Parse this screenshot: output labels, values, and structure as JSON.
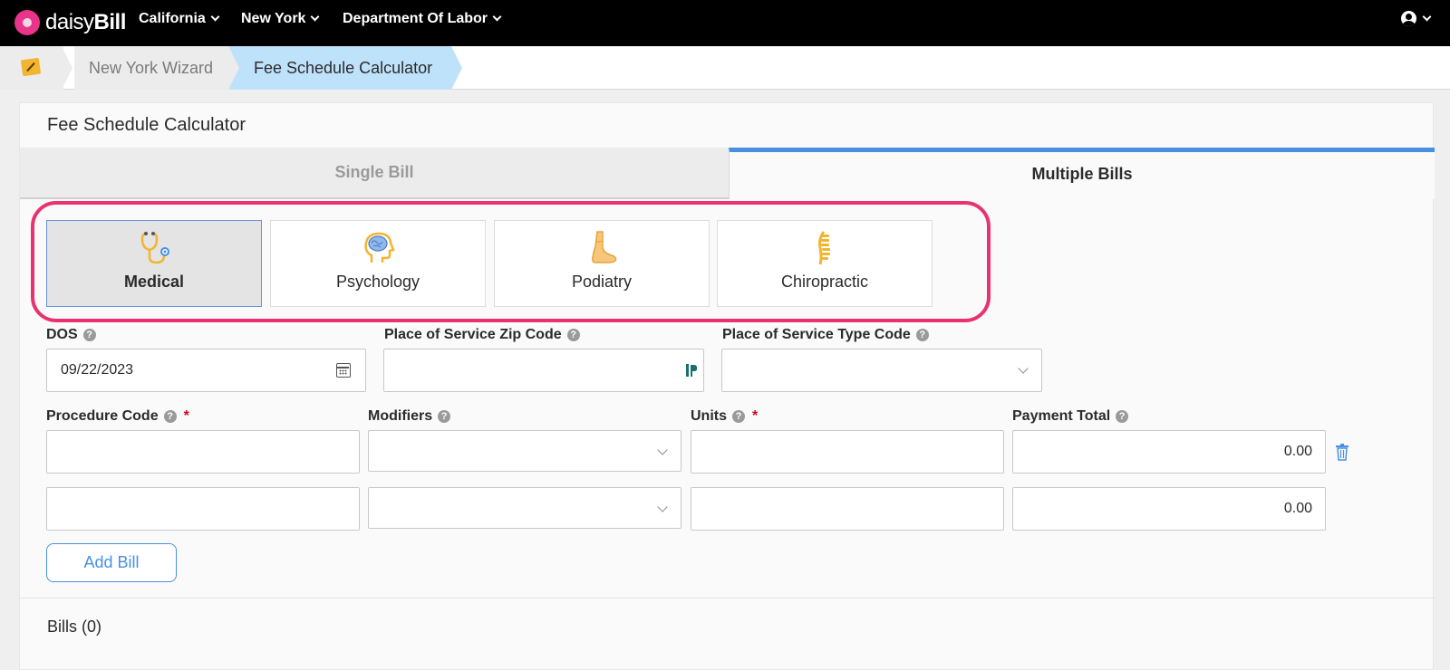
{
  "app": {
    "brand_light": "daisy",
    "brand_bold": "Bill"
  },
  "nav": {
    "items": [
      {
        "label": "California"
      },
      {
        "label": "New York"
      },
      {
        "label": "Department Of Labor"
      }
    ]
  },
  "breadcrumb": {
    "items": [
      "New York Wizard",
      "Fee Schedule Calculator"
    ]
  },
  "page": {
    "title": "Fee Schedule Calculator"
  },
  "tabs": [
    {
      "label": "Single Bill",
      "active": false
    },
    {
      "label": "Multiple Bills",
      "active": true
    }
  ],
  "disciplines": [
    {
      "label": "Medical",
      "icon": "stethoscope-icon",
      "selected": true
    },
    {
      "label": "Psychology",
      "icon": "brain-head-icon",
      "selected": false
    },
    {
      "label": "Podiatry",
      "icon": "foot-icon",
      "selected": false
    },
    {
      "label": "Chiropractic",
      "icon": "spine-icon",
      "selected": false
    }
  ],
  "form": {
    "dos_label": "DOS",
    "dos_value": "09/22/2023",
    "zip_label": "Place of Service Zip Code",
    "zip_value": "",
    "pos_type_label": "Place of Service Type Code",
    "pos_type_value": "",
    "procedure_label": "Procedure Code",
    "modifiers_label": "Modifiers",
    "units_label": "Units",
    "payment_label": "Payment Total",
    "required_mark": "*",
    "help_mark": "?",
    "rows": [
      {
        "procedure": "",
        "modifiers": "",
        "units": "",
        "payment": "0.00"
      },
      {
        "procedure": "",
        "modifiers": "",
        "units": "",
        "payment": "0.00"
      }
    ]
  },
  "actions": {
    "add_bill": "Add Bill"
  },
  "bills": {
    "summary": "Bills (0)"
  },
  "colors": {
    "accent": "#4a90e2",
    "highlight": "#e8336e",
    "breadcrumb_active": "#bfe2fb"
  }
}
